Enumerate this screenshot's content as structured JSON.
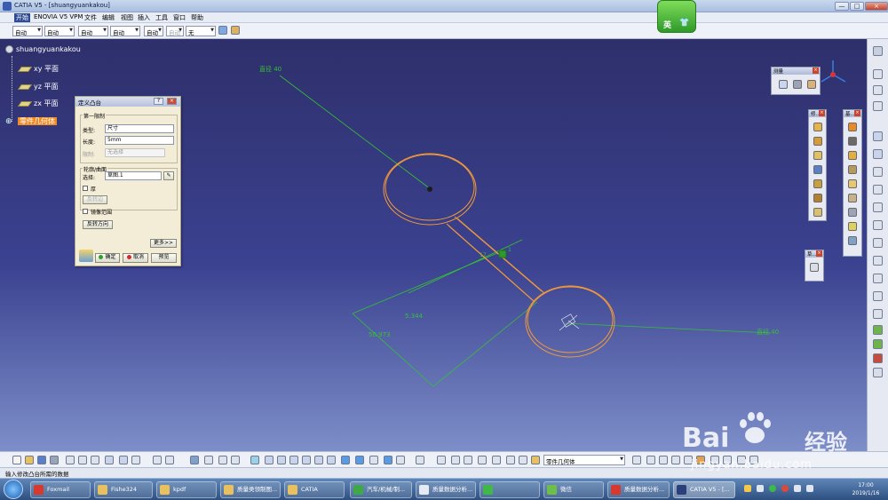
{
  "window": {
    "title": "CATIA V5 - [shuangyuankakou]",
    "buttons": [
      "—",
      "□",
      "×"
    ]
  },
  "menu": [
    "开始",
    "ENOVIA V5 VPM",
    "文件",
    "编辑",
    "视图",
    "插入",
    "工具",
    "窗口",
    "帮助"
  ],
  "dropdowns": [
    "自动",
    "自动",
    "自动",
    "自动",
    "自动",
    "自动",
    "无"
  ],
  "ime": {
    "label": "英",
    "shirt": "👕"
  },
  "tree": {
    "root": "shuangyuankakou",
    "items": [
      "xy 平面",
      "yz 平面",
      "zx 平面"
    ],
    "selected": "零件几何体"
  },
  "dialog": {
    "title": "定义凸台",
    "buttons": [
      "?",
      "×"
    ],
    "group1": "第一限制",
    "type_label": "类型:",
    "type_value": "尺寸",
    "length_label": "长度:",
    "length_value": "5mm",
    "limit_label": "限制:",
    "limit_value": "无选择",
    "group2": "轮廓/曲面",
    "select_label": "选择:",
    "select_value": "草图.1",
    "thick_label": "厚",
    "reverse_side": "反转边",
    "mirror_label": "镜像范围",
    "reverse_dir": "反转方向",
    "more": "更多>>",
    "ok": "确定",
    "cancel": "取消",
    "preview": "预览"
  },
  "canvas_labels": {
    "dim_top": "直径 40",
    "dim_right": "直径 40",
    "dim_mid": "5.344",
    "dim_long": "50.973",
    "dim_small1": "17",
    "dim_small2": "1"
  },
  "toolbars": {
    "measure": "测量",
    "t1": "修...",
    "t2": "基...",
    "t3": "草..."
  },
  "bottom": {
    "combo": "零件几何体"
  },
  "status": "输入修改凸台所需的数据",
  "taskbar": {
    "items": [
      "Foxmail",
      "Fishe324",
      "kpdf",
      "质量类领制图...",
      "CATIA",
      "汽车/机械/制...",
      "质量数据分析...",
      "",
      "微信",
      "质量数据分析...",
      "CATIA V5 - [..."
    ],
    "time": "17:00",
    "date": "2019/1/16"
  },
  "watermark": {
    "brand_left": "Bai",
    "brand_right": "经验",
    "url": "jingyan.baidu.com"
  },
  "colors": {
    "geometry": "#f39a3a",
    "dimension": "#34c234",
    "selected_tree": "#f08a24"
  }
}
